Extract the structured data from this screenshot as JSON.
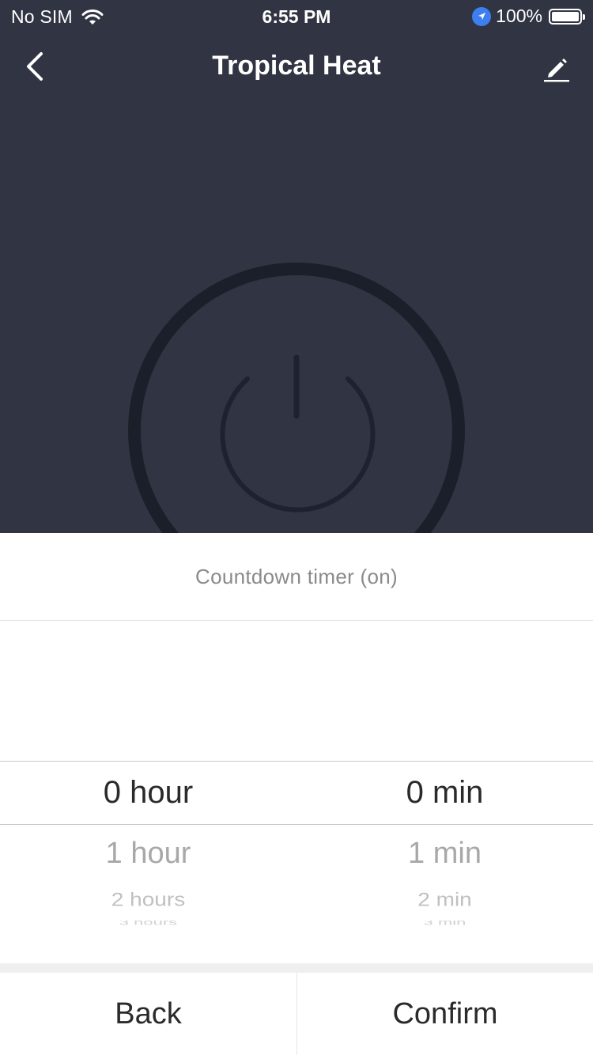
{
  "status_bar": {
    "carrier": "No SIM",
    "time": "6:55 PM",
    "battery": "100%",
    "icons": [
      "wifi-icon",
      "location-arrow-icon",
      "battery-icon"
    ]
  },
  "nav": {
    "title": "Tropical Heat",
    "back_icon": "chevron-left-icon",
    "edit_icon": "pencil-icon"
  },
  "power": {
    "icon": "power-icon",
    "state": "off"
  },
  "timer_sheet": {
    "title": "Countdown timer (on)",
    "hours": [
      "0 hour",
      "1 hour",
      "2 hours",
      "3 hours"
    ],
    "minutes": [
      "0 min",
      "1 min",
      "2 min",
      "3 min"
    ],
    "selected_hour": "0 hour",
    "selected_minute": "0 min",
    "back_label": "Back",
    "confirm_label": "Confirm"
  },
  "colors": {
    "header_bg": "#313543",
    "ring": "#1b1f2a",
    "power_icon": "#1e2230",
    "location_blue": "#3d7ff0"
  }
}
